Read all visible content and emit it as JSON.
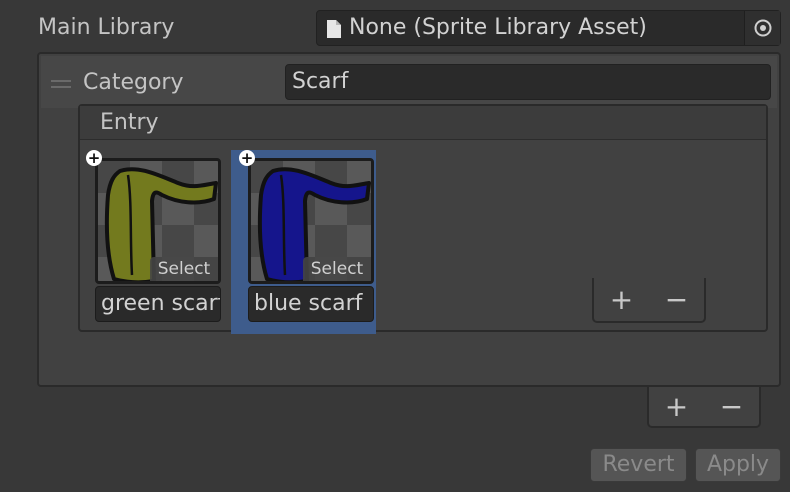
{
  "main_library": {
    "label": "Main Library",
    "value": "None (Sprite Library Asset)",
    "doc_icon": "document-icon",
    "picker_icon": "object-picker-icon"
  },
  "category": {
    "label": "Category",
    "value": "Scarf",
    "entry": {
      "label": "Entry",
      "items": [
        {
          "name": "green scarf",
          "select_label": "Select",
          "color": "#737a1e",
          "selected": false
        },
        {
          "name": "blue scarf",
          "select_label": "Select",
          "color": "#15158c",
          "selected": true
        }
      ],
      "add_label": "+",
      "remove_label": "−"
    },
    "add_label": "+",
    "remove_label": "−"
  },
  "footer": {
    "revert_label": "Revert",
    "apply_label": "Apply"
  },
  "colors": {
    "background": "#383838",
    "selection": "#3e5c8c"
  }
}
